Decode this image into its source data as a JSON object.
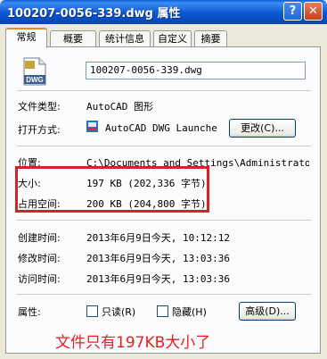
{
  "window": {
    "title": "100207-0056-339.dwg 属性",
    "help_glyph": "?",
    "close_glyph": "✕"
  },
  "tabs": [
    {
      "label": "常规",
      "active": true
    },
    {
      "label": "概要",
      "active": false
    },
    {
      "label": "统计信息",
      "active": false
    },
    {
      "label": "自定义",
      "active": false
    },
    {
      "label": "摘要",
      "active": false
    }
  ],
  "file": {
    "icon_label": "DWG",
    "name": "100207-0056-339.dwg"
  },
  "fields": {
    "type_label": "文件类型:",
    "type_value": "AutoCAD 图形",
    "open_label": "打开方式:",
    "open_value": "AutoCAD DWG Launche",
    "change_button": "更改(C)...",
    "location_label": "位置:",
    "location_value": "C:\\Documents and Settings\\Administrator\\桌",
    "size_label": "大小:",
    "size_value": "197 KB (202,336 字节)",
    "disk_label": "占用空间:",
    "disk_value": "200 KB (204,800 字节)",
    "created_label": "创建时间:",
    "created_value": "2013年6月9日今天, 10:12:12",
    "modified_label": "修改时间:",
    "modified_value": "2013年6月9日今天, 13:03:36",
    "accessed_label": "访问时间:",
    "accessed_value": "2013年6月9日今天, 13:03:36",
    "attr_label": "属性:",
    "readonly_label": "只读(R)",
    "hidden_label": "隐藏(H)",
    "advanced_button": "高级(D)..."
  },
  "annotation": "文件只有197KB大小了",
  "colors": {
    "highlight": "#d8202a",
    "annotation": "#e5211d",
    "titlebar": "#0b56d0"
  }
}
